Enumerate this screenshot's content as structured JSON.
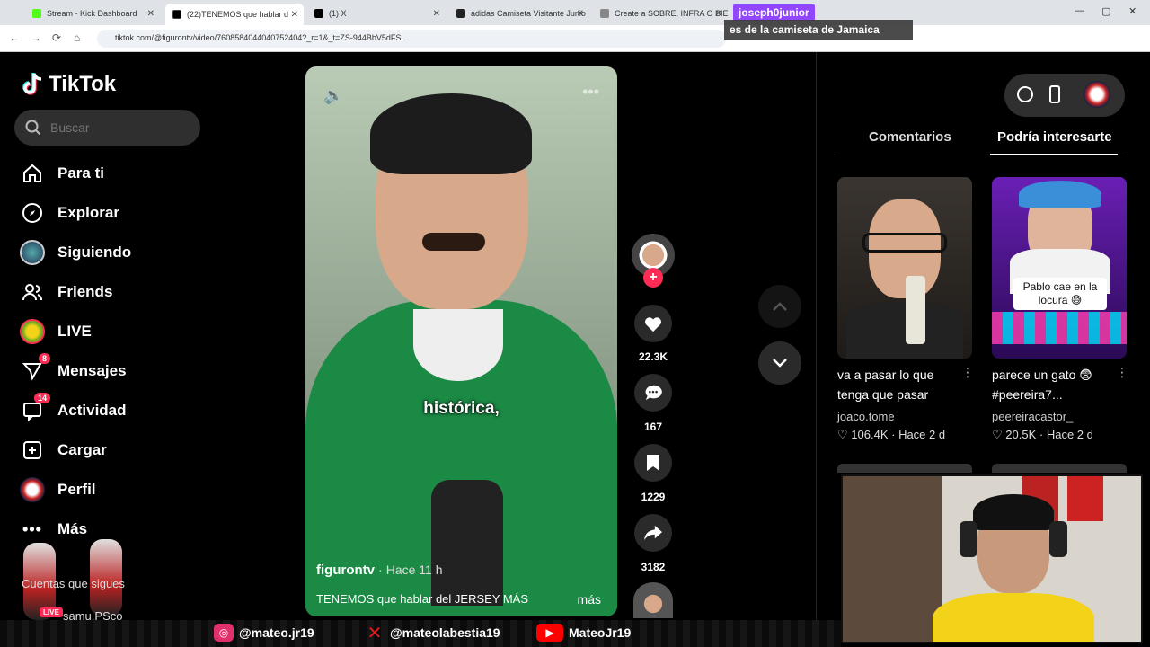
{
  "browser": {
    "tabs": [
      {
        "title": "Stream - Kick Dashboard",
        "active": false,
        "color": "#53fc18"
      },
      {
        "title": "(22)TENEMOS que hablar d",
        "active": true,
        "color": "#000000"
      },
      {
        "title": "(1) X",
        "active": false,
        "color": "#000000"
      },
      {
        "title": "adidas Camiseta Visitante Junio",
        "active": false,
        "color": "#000000"
      },
      {
        "title": "Create a SOBRE, INFRA O BIEN",
        "active": false,
        "color": "#888888"
      }
    ],
    "url": "tiktok.com/@figurontv/video/7608584044040752404?_r=1&_t=ZS-944BbV5dFSL"
  },
  "twitch_chat": {
    "username": "joseph0junior",
    "message": "es de la camiseta de Jamaica"
  },
  "sidebar": {
    "logo_text": "TikTok",
    "search_placeholder": "Buscar",
    "items": [
      {
        "label": "Para ti",
        "icon": "home-icon"
      },
      {
        "label": "Explorar",
        "icon": "compass-icon"
      },
      {
        "label": "Siguiendo",
        "icon": "following-avatar-icon"
      },
      {
        "label": "Friends",
        "icon": "friends-icon"
      },
      {
        "label": "LIVE",
        "icon": "live-avatar-icon"
      },
      {
        "label": "Mensajes",
        "icon": "messages-icon",
        "badge": "8"
      },
      {
        "label": "Actividad",
        "icon": "activity-icon",
        "badge": "14"
      },
      {
        "label": "Cargar",
        "icon": "upload-icon"
      },
      {
        "label": "Perfil",
        "icon": "profile-avatar-icon"
      },
      {
        "label": "Más",
        "icon": "more-icon"
      }
    ]
  },
  "video": {
    "caption": "histórica,",
    "author": "figurontv",
    "time": "· Hace 11 h",
    "description": "TENEMOS que hablar del JERSEY MÁS",
    "more_label": "más"
  },
  "actions": {
    "likes": "22.3K",
    "comments": "167",
    "saves": "1229",
    "shares": "3182"
  },
  "right_panel": {
    "tabs": [
      "Comentarios",
      "Podría interesarte"
    ],
    "active_tab": 1,
    "cards": [
      {
        "title": "va a pasar lo que tenga que pasar",
        "author": "joaco.tome",
        "likes": "106.4K",
        "time": "Hace 2 d",
        "overlay_text": ""
      },
      {
        "title": "parece un gato 😨 #peereira7...",
        "author": "peereiracastor_",
        "likes": "20.5K",
        "time": "Hace 2 d",
        "overlay_text": "Pablo cae en la locura 😅"
      }
    ]
  },
  "stream_overlay": {
    "socials": [
      {
        "handle": "@mateo.jr19",
        "icon": "instagram-icon",
        "color": "#e1306c"
      },
      {
        "handle": "@mateolabestia19",
        "icon": "x-icon",
        "color": "#e01b1b"
      },
      {
        "handle": "MateoJr19",
        "icon": "youtube-icon",
        "color": "#ff0000"
      }
    ],
    "left_text_1": "Cuentas que sigues",
    "left_text_2": "samu.PSco",
    "live_label": "LIVE"
  }
}
